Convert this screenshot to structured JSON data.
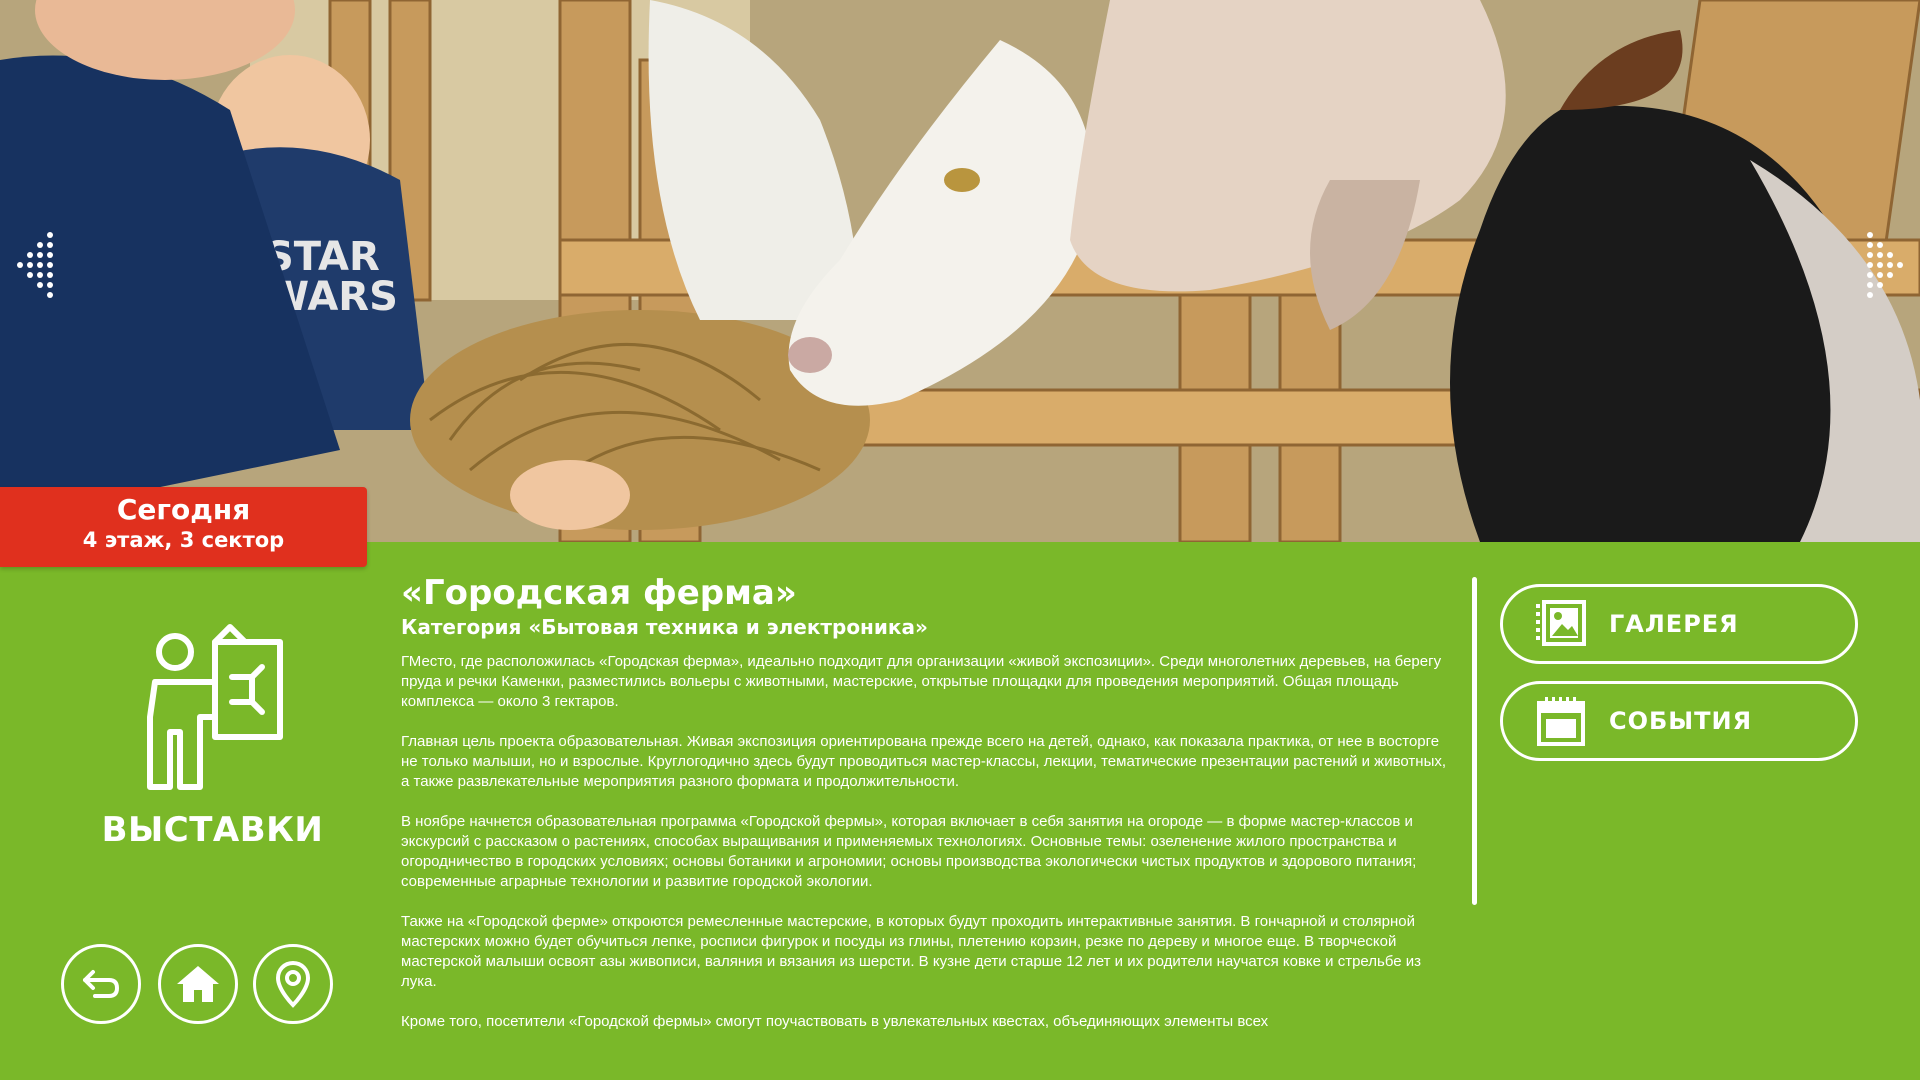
{
  "badge": {
    "title": "Сегодня",
    "location": "4 этаж, 3 сектор"
  },
  "category": {
    "label": "ВЫСТАВКИ",
    "icon": "exhibition-person-board-icon"
  },
  "article": {
    "title": "«Городская ферма»",
    "subtitle": "Категория «Бытовая техника и электроника»",
    "paragraphs": [
      "ГМесто, где расположилась «Городская ферма», идеально подходит для организации «живой экспозиции». Среди многолетних деревьев, на берегу пруда и речки Каменки, разместились вольеры с животными, мастерские, открытые площадки для проведения мероприятий. Общая площадь комплекса — около 3 гектаров.",
      "Главная цель проекта образовательная. Живая экспозиция ориентирована прежде всего на детей, однако, как показала практика, от нее в восторге не только малыши, но и взрослые. Круглогодично здесь будут проводиться мастер-классы, лекции, тематические презентации растений и животных, а также развлекательные мероприятия разного формата и продолжительности.",
      "В ноябре начнется образовательная программа «Городской фермы», которая включает в себя занятия на огороде — в форме мастер-классов и экскурсий с рассказом о растениях, способах выращивания и применяемых технологиях. Основные темы: озеленение жилого пространства и огородничество в городских условиях; основы ботаники и агрономии; основы производства экологически чистых продуктов и здорового питания; современные аграрные технологии и развитие городской экологии.",
      "Также на «Городской ферме» откроются ремесленные мастерские, в которых будут проходить интерактивные занятия. В гончарной и столярной мастерских можно будет обучиться лепке, росписи фигурок и посуды из глины, плетению корзин, резке по дереву и многое еще. В творческой мастерской малыши освоят азы живописи, валяния и вязания из шерсти. В кузне дети старше 12 лет и их родители научатся ковке и стрельбе из лука.",
      " Кроме того, посетители «Городской фермы» смогут поучаствовать в увлекательных квестах, объединяющих элементы всех"
    ]
  },
  "actions": {
    "gallery_label": "ГАЛЕРЕЯ",
    "gallery_icon": "gallery-icon",
    "events_label": "СОБЫТИЯ",
    "events_icon": "calendar-icon"
  },
  "navigation": {
    "back_icon": "back-arrow-icon",
    "home_icon": "home-icon",
    "map_icon": "map-pin-icon",
    "prev_icon": "dotted-arrow-left-icon",
    "next_icon": "dotted-arrow-right-icon"
  },
  "colors": {
    "background_green": "#7ab829",
    "badge_red": "#e0301e",
    "foreground": "#ffffff"
  },
  "hero_image": "children feeding goats hay at a wooden fence"
}
